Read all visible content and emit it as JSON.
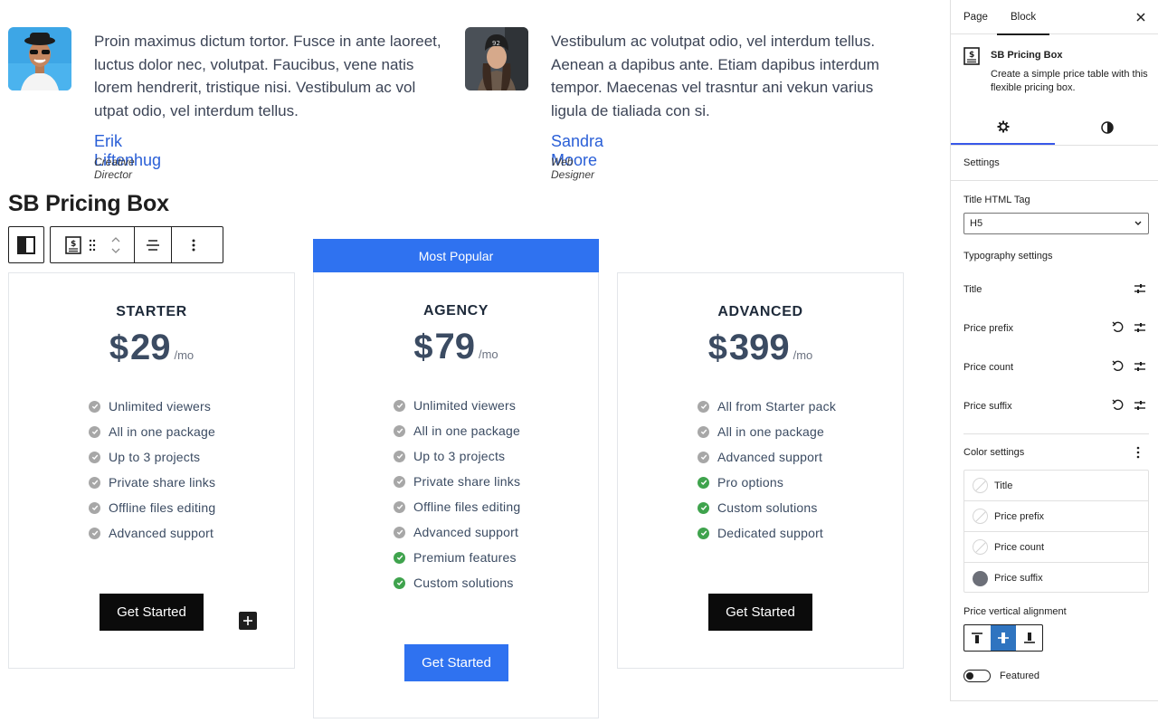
{
  "testimonials": [
    {
      "quote": "Proin maximus dictum tortor. Fusce in ante laoreet, luctus dolor nec, volutpat. Faucibus, vene natis lorem hendrerit, tristique nisi. Vestibulum ac vol utpat odio, vel interdum tellus.",
      "name": "Erik Liftenhug",
      "role": "Creative Director"
    },
    {
      "quote": "Vestibulum ac volutpat odio, vel interdum tellus. Aenean a dapibus ante. Etiam dapibus interdum tempor. Maecenas vel trasntur ani  vekun varius ligula de tialiada con si.",
      "name": "Sandra Moore",
      "role": "Web Designer"
    }
  ],
  "section_title": "SB Pricing Box",
  "pricing": {
    "badge": "Most Popular",
    "plans": [
      {
        "title": "STARTER",
        "prefix": "$",
        "count": "29",
        "suffix": "/mo",
        "features": [
          {
            "text": "Unlimited viewers",
            "highlight": false
          },
          {
            "text": "All in one package",
            "highlight": false
          },
          {
            "text": "Up to 3 projects",
            "highlight": false
          },
          {
            "text": "Private share links",
            "highlight": false
          },
          {
            "text": "Offline files editing",
            "highlight": false
          },
          {
            "text": "Advanced support",
            "highlight": false
          }
        ],
        "button": "Get Started"
      },
      {
        "title": "AGENCY",
        "prefix": "$",
        "count": "79",
        "suffix": "/mo",
        "features": [
          {
            "text": "Unlimited viewers",
            "highlight": false
          },
          {
            "text": "All in one package",
            "highlight": false
          },
          {
            "text": "Up to 3 projects",
            "highlight": false
          },
          {
            "text": "Private share links",
            "highlight": false
          },
          {
            "text": "Offline files editing",
            "highlight": false
          },
          {
            "text": "Advanced support",
            "highlight": false
          },
          {
            "text": "Premium features",
            "highlight": true
          },
          {
            "text": "Custom solutions",
            "highlight": true
          }
        ],
        "button": "Get Started"
      },
      {
        "title": "ADVANCED",
        "prefix": "$",
        "count": "399",
        "suffix": "/mo",
        "features": [
          {
            "text": "All from Starter pack",
            "highlight": false
          },
          {
            "text": "All in one package",
            "highlight": false
          },
          {
            "text": "Advanced support",
            "highlight": false
          },
          {
            "text": "Pro options",
            "highlight": true
          },
          {
            "text": "Custom solutions",
            "highlight": true
          },
          {
            "text": "Dedicated support",
            "highlight": true
          }
        ],
        "button": "Get Started"
      }
    ]
  },
  "sidebar": {
    "tabs": [
      "Page",
      "Block"
    ],
    "active_tab": "Block",
    "block_name": "SB Pricing Box",
    "block_description": "Create a simple price table with this flexible pricing box.",
    "settings_heading": "Settings",
    "title_tag_label": "Title HTML Tag",
    "title_tag_value": "H5",
    "typography_heading": "Typography settings",
    "typography_items": [
      "Title",
      "Price prefix",
      "Price count",
      "Price suffix"
    ],
    "color_heading": "Color settings",
    "color_items": [
      {
        "label": "Title",
        "color": null
      },
      {
        "label": "Price prefix",
        "color": null
      },
      {
        "label": "Price count",
        "color": null
      },
      {
        "label": "Price suffix",
        "color": "#6c6f78"
      }
    ],
    "alignment_label": "Price vertical alignment",
    "alignment_options": [
      "top",
      "center",
      "bottom"
    ],
    "alignment_selected": "center",
    "featured_label": "Featured",
    "featured_on": false
  },
  "colors": {
    "accent": "#2f72f0",
    "check_default": "#a7a7a7",
    "check_highlight": "#3fa34d",
    "text": "#3b4b62"
  }
}
